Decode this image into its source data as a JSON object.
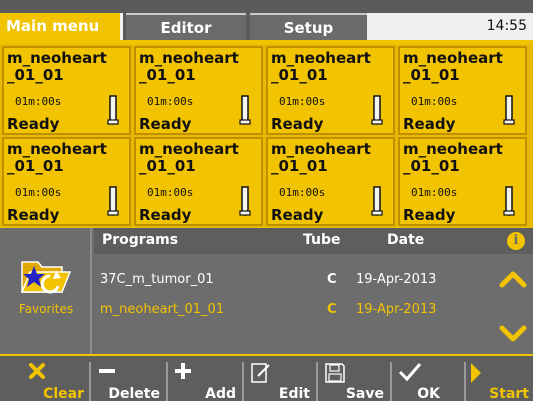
{
  "tabs": {
    "main": "Main menu",
    "editor": "Editor",
    "setup": "Setup"
  },
  "clock": "14:55",
  "tiles": [
    {
      "name": "m_neoheart\n_01_01",
      "time": "01m:00s",
      "status": "Ready"
    },
    {
      "name": "m_neoheart\n_01_01",
      "time": "01m:00s",
      "status": "Ready"
    },
    {
      "name": "m_neoheart\n_01_01",
      "time": "01m:00s",
      "status": "Ready"
    },
    {
      "name": "m_neoheart\n_01_01",
      "time": "01m:00s",
      "status": "Ready"
    },
    {
      "name": "m_neoheart\n_01_01",
      "time": "01m:00s",
      "status": "Ready"
    },
    {
      "name": "m_neoheart\n_01_01",
      "time": "01m:00s",
      "status": "Ready"
    },
    {
      "name": "m_neoheart\n_01_01",
      "time": "01m:00s",
      "status": "Ready"
    },
    {
      "name": "m_neoheart\n_01_01",
      "time": "01m:00s",
      "status": "Ready"
    }
  ],
  "favorites": {
    "label": "Favorites",
    "icon": "favorites-folder-icon"
  },
  "list": {
    "headers": {
      "programs": "Programs",
      "tube": "Tube",
      "date": "Date"
    },
    "rows": [
      {
        "program": "37C_m_tumor_01",
        "tube": "C",
        "date": "19-Apr-2013"
      },
      {
        "program": "m_neoheart_01_01",
        "tube": "C",
        "date": "19-Apr-2013"
      }
    ]
  },
  "toolbar": {
    "clear": "Clear",
    "delete": "Delete",
    "add": "Add",
    "edit": "Edit",
    "save": "Save",
    "ok": "OK",
    "start": "Start"
  },
  "colors": {
    "accent": "#f2c300",
    "background": "#6d6d6d",
    "tile_border": "#c08f00"
  }
}
